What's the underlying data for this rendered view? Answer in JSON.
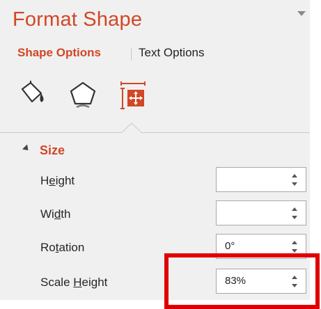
{
  "panel": {
    "title": "Format Shape",
    "tabs": [
      {
        "label": "Shape Options",
        "active": true
      },
      {
        "label": "Text Options",
        "active": false
      }
    ],
    "icons": [
      "fill-line-icon",
      "effects-icon",
      "size-properties-icon"
    ],
    "accent_color": "#d24726"
  },
  "size_section": {
    "title": "Size",
    "fields": [
      {
        "label_pre": "H",
        "label_u": "e",
        "label_post": "ight",
        "value": ""
      },
      {
        "label_pre": "Wi",
        "label_u": "d",
        "label_post": "th",
        "value": ""
      },
      {
        "label_pre": "Ro",
        "label_u": "t",
        "label_post": "ation",
        "value": "0°"
      },
      {
        "label_pre": "Scale ",
        "label_u": "H",
        "label_post": "eight",
        "value": "83%"
      }
    ]
  },
  "annotation": {
    "highlight_color": "#e00000"
  }
}
